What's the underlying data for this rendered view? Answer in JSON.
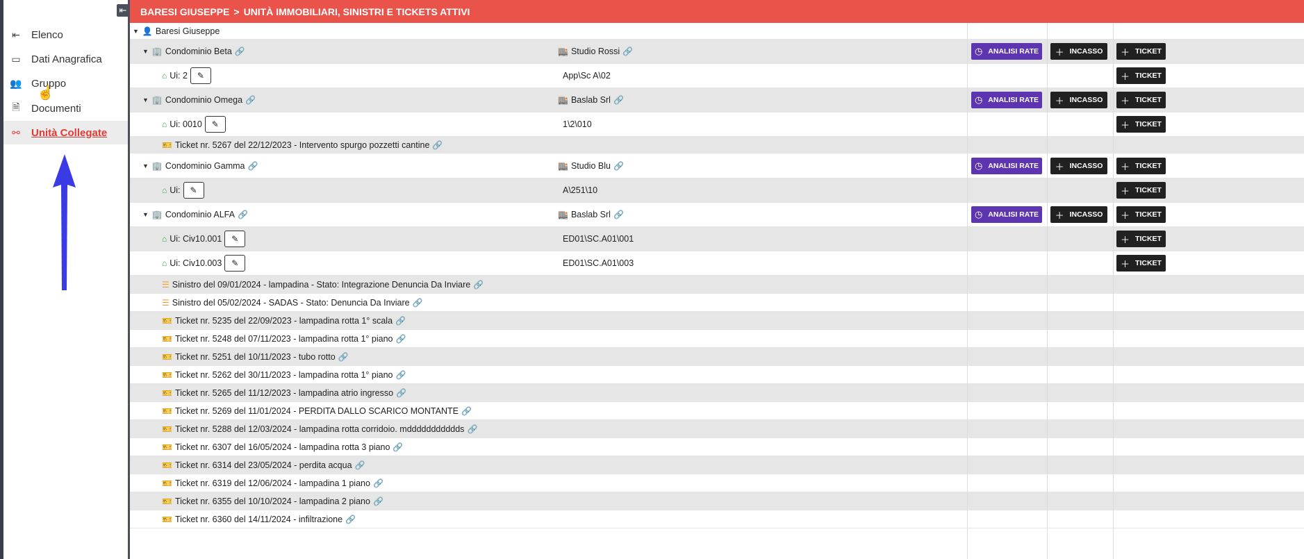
{
  "sidebar": {
    "collapse_icon": "collapse-icon",
    "items": [
      {
        "label": "Elenco",
        "icon": "back-arrow-icon"
      },
      {
        "label": "Dati Anagrafica",
        "icon": "id-card-icon"
      },
      {
        "label": "Gruppo",
        "icon": "group-icon"
      },
      {
        "label": "Documenti",
        "icon": "document-icon"
      },
      {
        "label": "Unità Collegate",
        "icon": "link-units-icon",
        "active": true
      }
    ]
  },
  "header": {
    "name": "BARESI GIUSEPPE",
    "separator": ">",
    "title": "UNITÀ IMMOBILIARI, SINISTRI E TICKETS ATTIVI"
  },
  "buttons": {
    "analisi": "ANALISI RATE",
    "incasso": "INCASSO",
    "ticket": "TICKET"
  },
  "tree": {
    "root": "Baresi Giuseppe",
    "condo1": {
      "name": "Condominio Beta",
      "admin": "Studio Rossi"
    },
    "ui1": {
      "label": "Ui: 2",
      "code": "App\\Sc A\\02"
    },
    "condo2": {
      "name": "Condominio Omega",
      "admin": "Baslab Srl"
    },
    "ui2": {
      "label": "Ui: 0010",
      "code": "1\\2\\010"
    },
    "ticket_omega": "Ticket nr. 5267 del 22/12/2023 - Intervento spurgo pozzetti cantine",
    "condo3": {
      "name": "Condominio Gamma",
      "admin": "Studio Blu"
    },
    "ui3": {
      "label": "Ui:",
      "code": "A\\251\\10"
    },
    "condo4": {
      "name": "Condominio ALFA",
      "admin": "Baslab Srl"
    },
    "ui4": {
      "label": "Ui: Civ10.001",
      "code": "ED01\\SC.A01\\001"
    },
    "ui5": {
      "label": "Ui: Civ10.003",
      "code": "ED01\\SC.A01\\003"
    },
    "sinistri": [
      "Sinistro del 09/01/2024 - lampadina - Stato: Integrazione Denuncia Da Inviare",
      "Sinistro del 05/02/2024 - SADAS - Stato: Denuncia Da Inviare"
    ],
    "tickets": [
      "Ticket nr. 5235 del 22/09/2023 - lampadina rotta 1° scala",
      "Ticket nr. 5248 del 07/11/2023 - lampadina rotta 1° piano",
      "Ticket nr. 5251 del 10/11/2023 - tubo rotto",
      "Ticket nr. 5262 del 30/11/2023 - lampadina rotta 1° piano",
      "Ticket nr. 5265 del 11/12/2023 - lampadina atrio ingresso",
      "Ticket nr. 5269 del 11/01/2024 - PERDITA DALLO SCARICO MONTANTE",
      "Ticket nr. 5288 del 12/03/2024 - lampadina rotta corridoio. mddddddddddds",
      "Ticket nr. 6307 del 16/05/2024 - lampadina rotta 3 piano",
      "Ticket nr. 6314 del 23/05/2024 - perdita acqua",
      "Ticket nr. 6319 del 12/06/2024 - lampadina 1 piano",
      "Ticket nr. 6355 del 10/10/2024 - lampadina 2 piano",
      "Ticket nr. 6360 del 14/11/2024 - infiltrazione"
    ]
  },
  "colors": {
    "header": "#e9534a",
    "accent_red": "#e53935",
    "purple_button": "#5e35b1",
    "dark_button": "#212121",
    "row_alt": "#e6e6e6"
  }
}
